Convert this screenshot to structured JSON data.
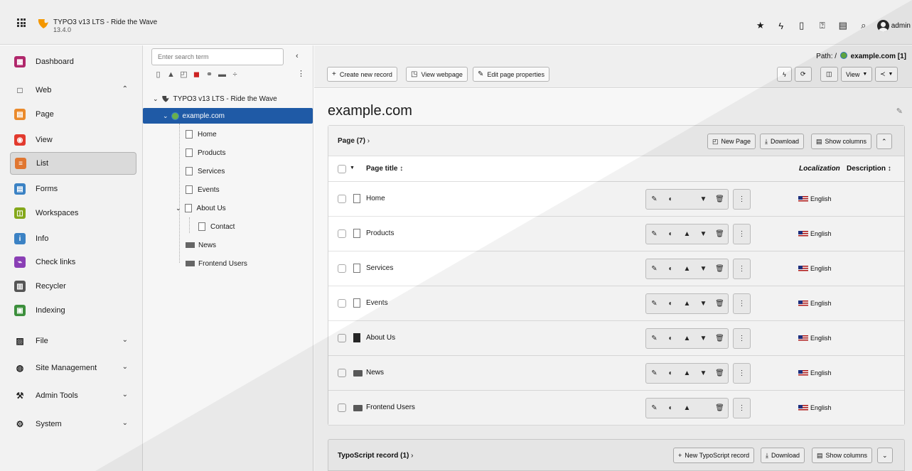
{
  "topbar": {
    "site_name": "TYPO3 v13 LTS - Ride the Wave",
    "version": "13.4.0",
    "user": "admin",
    "icons": [
      "star-icon",
      "bolt-icon",
      "document-icon",
      "help-icon",
      "list-icon",
      "search-icon"
    ]
  },
  "modules": [
    {
      "label": "Dashboard",
      "color": "#b0276b",
      "glyph": "▦"
    },
    {
      "label": "Web",
      "color": "",
      "glyph": "□",
      "chevron": "up"
    },
    {
      "label": "Page",
      "color": "#ea8a2b",
      "glyph": "▤"
    },
    {
      "label": "View",
      "color": "#e23a2e",
      "glyph": "◉"
    },
    {
      "label": "List",
      "color": "#e07631",
      "glyph": "≡",
      "active": true
    },
    {
      "label": "Forms",
      "color": "#3b82c4",
      "glyph": "▤"
    },
    {
      "label": "Workspaces",
      "color": "#84a81b",
      "glyph": "◫"
    },
    {
      "label": "Info",
      "color": "#3b82c4",
      "glyph": "i"
    },
    {
      "label": "Check links",
      "color": "#8a3fb5",
      "glyph": "⌁"
    },
    {
      "label": "Recycler",
      "color": "#555555",
      "glyph": "▥"
    },
    {
      "label": "Indexing",
      "color": "#3c8f3c",
      "glyph": "▣"
    },
    {
      "label": "File",
      "color": "",
      "glyph": "▨",
      "chevron": "down"
    },
    {
      "label": "Site Management",
      "color": "",
      "glyph": "◍",
      "chevron": "down"
    },
    {
      "label": "Admin Tools",
      "color": "",
      "glyph": "⚒",
      "chevron": "down"
    },
    {
      "label": "System",
      "color": "",
      "glyph": "⚙",
      "chevron": "down"
    }
  ],
  "tree": {
    "search_placeholder": "Enter search term",
    "root": "TYPO3 v13 LTS - Ride the Wave",
    "site": "example.com",
    "nodes": [
      "Home",
      "Products",
      "Services",
      "Events",
      "About Us",
      "Contact",
      "News",
      "Frontend Users"
    ]
  },
  "toolbar": {
    "path_label": "Path: /",
    "path_value": "example.com [1]",
    "create_record": "Create new record",
    "view_webpage": "View webpage",
    "edit_page": "Edit page properties",
    "view_dropdown": "View"
  },
  "page": {
    "title": "example.com",
    "panel_title": "Page (7)",
    "new_page": "New Page",
    "download": "Download",
    "show_columns": "Show columns",
    "col_title": "Page title",
    "col_localization": "Localization",
    "col_description": "Description",
    "rows": [
      {
        "title": "Home",
        "lang": "English",
        "type": "home"
      },
      {
        "title": "Products",
        "lang": "English",
        "type": "page"
      },
      {
        "title": "Services",
        "lang": "English",
        "type": "page"
      },
      {
        "title": "Events",
        "lang": "English",
        "type": "page"
      },
      {
        "title": "About Us",
        "lang": "English",
        "type": "pagedark"
      },
      {
        "title": "News",
        "lang": "English",
        "type": "folder"
      },
      {
        "title": "Frontend Users",
        "lang": "English",
        "type": "folder"
      }
    ],
    "panel2_title": "TypoScript record (1)",
    "new_ts": "New TypoScript record",
    "download2": "Download",
    "show_columns2": "Show columns"
  }
}
